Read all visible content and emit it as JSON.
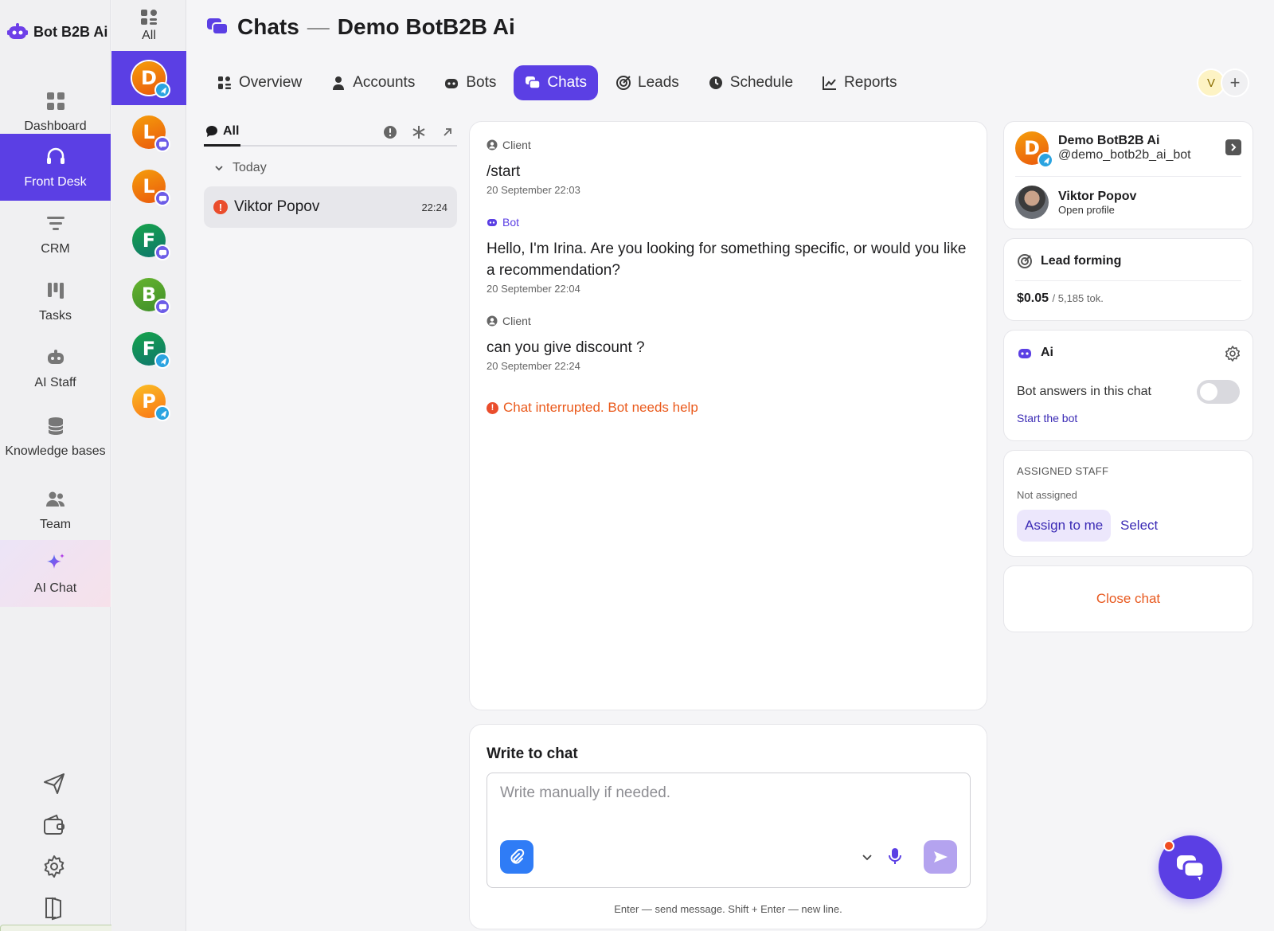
{
  "brand": {
    "name": "Bot B2B Ai",
    "accent": "#5b3fe4"
  },
  "nav": {
    "items": [
      {
        "label": "Dashboard",
        "icon": "dashboard-icon"
      },
      {
        "label": "Front Desk",
        "icon": "headset-icon",
        "active": true
      },
      {
        "label": "CRM",
        "icon": "funnel-icon"
      },
      {
        "label": "Tasks",
        "icon": "kanban-icon"
      },
      {
        "label": "AI Staff",
        "icon": "robot-icon"
      },
      {
        "label": "Knowledge bases",
        "icon": "database-icon"
      },
      {
        "label": "Team",
        "icon": "team-icon"
      },
      {
        "label": "AI Chat",
        "icon": "sparkle-icon"
      }
    ],
    "bottom": [
      "send-icon",
      "wallet-icon",
      "settings-icon",
      "logout-icon"
    ]
  },
  "accounts": {
    "all_label": "All",
    "items": [
      {
        "letter": "D",
        "color": "orange",
        "channel": "telegram",
        "active": true
      },
      {
        "letter": "L",
        "color": "orange",
        "channel": "chat"
      },
      {
        "letter": "L",
        "color": "orange",
        "channel": "chat"
      },
      {
        "letter": "F",
        "color": "green",
        "channel": "chat"
      },
      {
        "letter": "B",
        "color": "lime",
        "channel": "chat"
      },
      {
        "letter": "F",
        "color": "green",
        "channel": "telegram"
      },
      {
        "letter": "P",
        "color": "yellow",
        "channel": "telegram"
      }
    ]
  },
  "header": {
    "title": "Chats",
    "dash": "—",
    "subtitle": "Demo BotB2B Ai",
    "user_initial": "V",
    "add_label": "+"
  },
  "tabs": [
    {
      "label": "Overview",
      "icon": "overview-icon"
    },
    {
      "label": "Accounts",
      "icon": "user-icon"
    },
    {
      "label": "Bots",
      "icon": "bot-icon"
    },
    {
      "label": "Chats",
      "icon": "chats-icon",
      "active": true
    },
    {
      "label": "Leads",
      "icon": "target-icon"
    },
    {
      "label": "Schedule",
      "icon": "clock-icon"
    },
    {
      "label": "Reports",
      "icon": "chart-icon"
    }
  ],
  "chat_list": {
    "filter_label": "All",
    "group": "Today",
    "rows": [
      {
        "name": "Viktor Popov",
        "time": "22:24",
        "alert": "!"
      }
    ]
  },
  "conversation": {
    "messages": [
      {
        "role": "Client",
        "text": "/start",
        "time": "20 September 22:03"
      },
      {
        "role": "Bot",
        "text": "Hello, I'm Irina. Are you looking for something specific, or would you like a recommendation?",
        "time": "20 September 22:04"
      },
      {
        "role": "Client",
        "text": "can you give discount ?",
        "time": "20 September 22:24"
      }
    ],
    "interrupt": "Chat interrupted. Bot needs help"
  },
  "composer": {
    "title": "Write to chat",
    "placeholder": "Write manually if needed.",
    "hint": "Enter — send message. Shift + Enter — new line."
  },
  "side": {
    "bot": {
      "initial": "D",
      "name": "Demo BotB2B Ai",
      "handle": "@demo_botb2b_ai_bot"
    },
    "client": {
      "name": "Viktor Popov",
      "link": "Open profile"
    },
    "lead": {
      "title": "Lead forming",
      "cost": "$0.05",
      "tokens": "/ 5,185 tok."
    },
    "ai": {
      "title": "Ai",
      "toggle_label": "Bot answers in this chat",
      "toggle_on": false,
      "start": "Start the bot"
    },
    "staff": {
      "title": "ASSIGNED STAFF",
      "status": "Not assigned",
      "assign": "Assign to me",
      "select": "Select"
    },
    "close": "Close chat"
  }
}
